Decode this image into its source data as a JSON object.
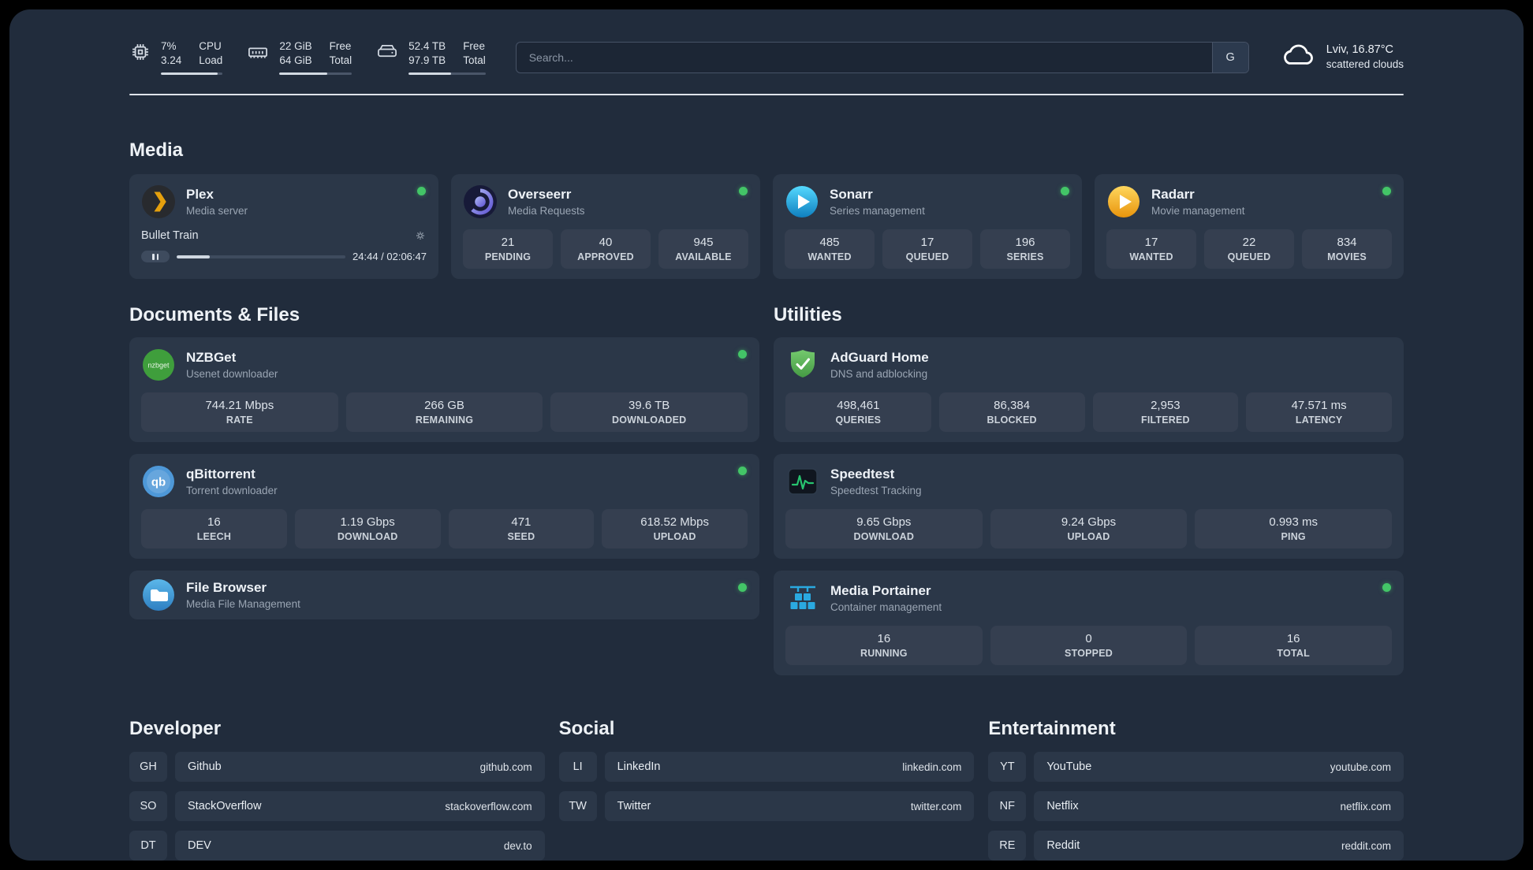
{
  "colors": {
    "status_online": "#43c567",
    "panel_bg": "#212c3c",
    "card_bg": "#2b3748",
    "tile_bg": "#353f50",
    "accent_plex": "#e5a00d",
    "accent_sonarr": "#35c5f4",
    "accent_radarr": "#ffc230",
    "accent_nzbget": "#3f9e3c",
    "accent_qbittorrent": "#4e98d8",
    "accent_adguard": "#5fae58",
    "accent_speedtest": "#27c46f",
    "accent_portainer": "#2aa9e0"
  },
  "topbar": {
    "cpu": {
      "icon": "cpu-icon",
      "value_top": "7%",
      "value_bottom": "3.24",
      "label_top": "CPU",
      "label_bottom": "Load",
      "progress_pct": 92
    },
    "ram": {
      "icon": "ram-icon",
      "value_top": "22 GiB",
      "value_bottom": "64 GiB",
      "label_top": "Free",
      "label_bottom": "Total",
      "progress_pct": 66
    },
    "disk": {
      "icon": "disk-icon",
      "value_top": "52.4 TB",
      "value_bottom": "97.9 TB",
      "label_top": "Free",
      "label_bottom": "Total",
      "progress_pct": 55
    },
    "search": {
      "placeholder": "Search...",
      "engine_button": "G"
    },
    "weather": {
      "location": "Lviv, 16.87°C",
      "condition": "scattered clouds"
    }
  },
  "sections": {
    "media": {
      "title": "Media"
    },
    "documents": {
      "title": "Documents & Files"
    },
    "utilities": {
      "title": "Utilities"
    },
    "developer": {
      "title": "Developer"
    },
    "social": {
      "title": "Social"
    },
    "entertainment": {
      "title": "Entertainment"
    }
  },
  "apps": {
    "plex": {
      "name": "Plex",
      "desc": "Media server",
      "online": true,
      "player": {
        "title": "Bullet Train",
        "time": "24:44 / 02:06:47",
        "progress_pct": 19.5
      }
    },
    "overseerr": {
      "name": "Overseerr",
      "desc": "Media Requests",
      "online": true,
      "stats": [
        {
          "value": "21",
          "label": "PENDING"
        },
        {
          "value": "40",
          "label": "APPROVED"
        },
        {
          "value": "945",
          "label": "AVAILABLE"
        }
      ]
    },
    "sonarr": {
      "name": "Sonarr",
      "desc": "Series management",
      "online": true,
      "stats": [
        {
          "value": "485",
          "label": "WANTED"
        },
        {
          "value": "17",
          "label": "QUEUED"
        },
        {
          "value": "196",
          "label": "SERIES"
        }
      ]
    },
    "radarr": {
      "name": "Radarr",
      "desc": "Movie management",
      "online": true,
      "stats": [
        {
          "value": "17",
          "label": "WANTED"
        },
        {
          "value": "22",
          "label": "QUEUED"
        },
        {
          "value": "834",
          "label": "MOVIES"
        }
      ]
    },
    "nzbget": {
      "name": "NZBGet",
      "desc": "Usenet downloader",
      "online": true,
      "icon_text": "nzbget",
      "stats": [
        {
          "value": "744.21 Mbps",
          "label": "RATE"
        },
        {
          "value": "266 GB",
          "label": "REMAINING"
        },
        {
          "value": "39.6 TB",
          "label": "DOWNLOADED"
        }
      ]
    },
    "qbittorrent": {
      "name": "qBittorrent",
      "desc": "Torrent downloader",
      "online": true,
      "icon_text": "qb",
      "stats": [
        {
          "value": "16",
          "label": "LEECH"
        },
        {
          "value": "1.19 Gbps",
          "label": "DOWNLOAD"
        },
        {
          "value": "471",
          "label": "SEED"
        },
        {
          "value": "618.52 Mbps",
          "label": "UPLOAD"
        }
      ]
    },
    "filebrowser": {
      "name": "File Browser",
      "desc": "Media File Management",
      "online": true
    },
    "adguard": {
      "name": "AdGuard Home",
      "desc": "DNS and adblocking",
      "stats": [
        {
          "value": "498,461",
          "label": "QUERIES"
        },
        {
          "value": "86,384",
          "label": "BLOCKED"
        },
        {
          "value": "2,953",
          "label": "FILTERED"
        },
        {
          "value": "47.571 ms",
          "label": "LATENCY"
        }
      ]
    },
    "speedtest": {
      "name": "Speedtest",
      "desc": "Speedtest Tracking",
      "stats": [
        {
          "value": "9.65 Gbps",
          "label": "DOWNLOAD"
        },
        {
          "value": "9.24 Gbps",
          "label": "UPLOAD"
        },
        {
          "value": "0.993 ms",
          "label": "PING"
        }
      ]
    },
    "portainer": {
      "name": "Media Portainer",
      "desc": "Container management",
      "online": true,
      "stats": [
        {
          "value": "16",
          "label": "RUNNING"
        },
        {
          "value": "0",
          "label": "STOPPED"
        },
        {
          "value": "16",
          "label": "TOTAL"
        }
      ]
    }
  },
  "bookmarks": {
    "developer": [
      {
        "abbr": "GH",
        "name": "Github",
        "url": "github.com"
      },
      {
        "abbr": "SO",
        "name": "StackOverflow",
        "url": "stackoverflow.com"
      },
      {
        "abbr": "DT",
        "name": "DEV",
        "url": "dev.to"
      }
    ],
    "social": [
      {
        "abbr": "LI",
        "name": "LinkedIn",
        "url": "linkedin.com"
      },
      {
        "abbr": "TW",
        "name": "Twitter",
        "url": "twitter.com"
      }
    ],
    "entertainment": [
      {
        "abbr": "YT",
        "name": "YouTube",
        "url": "youtube.com"
      },
      {
        "abbr": "NF",
        "name": "Netflix",
        "url": "netflix.com"
      },
      {
        "abbr": "RE",
        "name": "Reddit",
        "url": "reddit.com"
      }
    ]
  }
}
